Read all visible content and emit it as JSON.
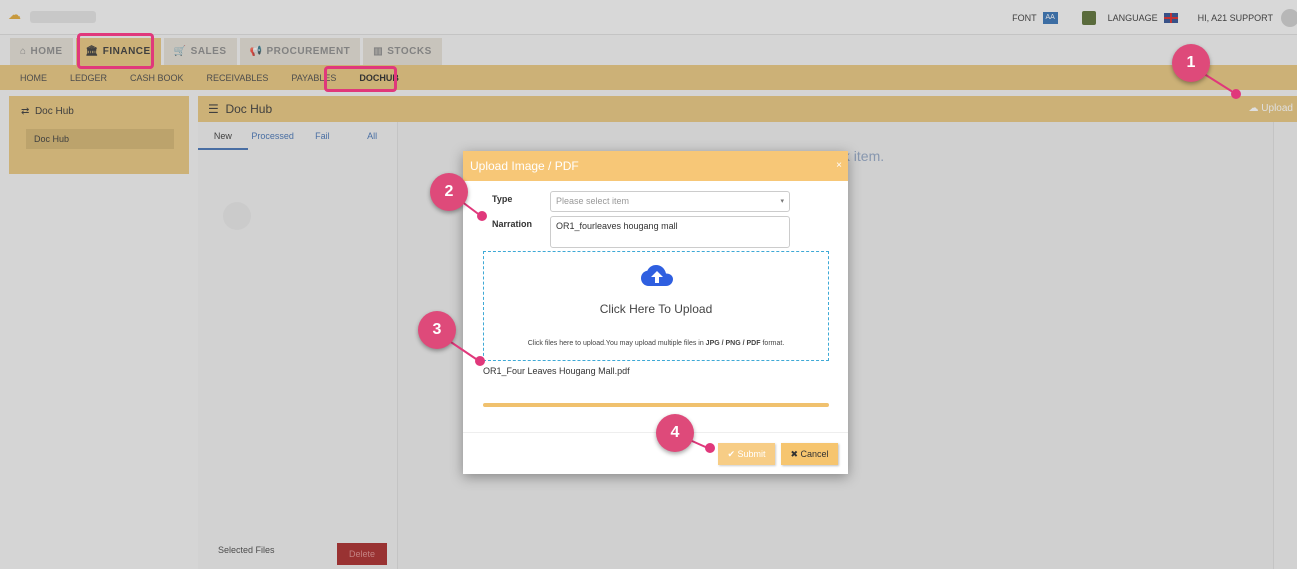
{
  "topbar": {
    "font_label": "FONT",
    "font_badge": "AA",
    "language_label": "LANGUAGE",
    "greeting": "HI, A21 SUPPORT"
  },
  "modules": [
    {
      "label": "HOME",
      "icon": "home-icon"
    },
    {
      "label": "FINANCE",
      "icon": "bank-icon",
      "active": true
    },
    {
      "label": "SALES",
      "icon": "cart-icon"
    },
    {
      "label": "PROCUREMENT",
      "icon": "megaphone-icon"
    },
    {
      "label": "STOCKS",
      "icon": "chart-icon"
    }
  ],
  "subnav": [
    "HOME",
    "LEDGER",
    "CASH BOOK",
    "RECEIVABLES",
    "PAYABLES",
    "DOCHUB"
  ],
  "sidebar": {
    "title": "Doc Hub",
    "item": "Doc Hub"
  },
  "dochub": {
    "title": "Doc Hub",
    "upload_label": "Upload",
    "tabs": [
      "New",
      "Processed",
      "Fail",
      "All"
    ],
    "placeholder": "Please click item.",
    "selected_files_label": "Selected Files",
    "delete_label": "Delete"
  },
  "modal": {
    "title": "Upload Image / PDF",
    "close": "×",
    "type_label": "Type",
    "type_placeholder": "Please select item",
    "narration_label": "Narration",
    "narration_value": "OR1_fourleaves hougang mall",
    "dropzone_title": "Click Here To Upload",
    "dropzone_note_prefix": "Click files here to upload.You may upload multiple files in ",
    "dropzone_note_formats": "JPG / PNG / PDF",
    "dropzone_note_suffix": " format.",
    "file_name": "OR1_Four Leaves Hougang Mall.pdf",
    "progress_percent": 100,
    "submit_label": "Submit",
    "cancel_label": "Cancel"
  },
  "callouts": [
    "1",
    "2",
    "3",
    "4"
  ],
  "colors": {
    "accent": "#e7c47a",
    "modal_header": "#f7c777",
    "highlight": "#e0387b",
    "cloud_icon": "#2f5fe0"
  }
}
